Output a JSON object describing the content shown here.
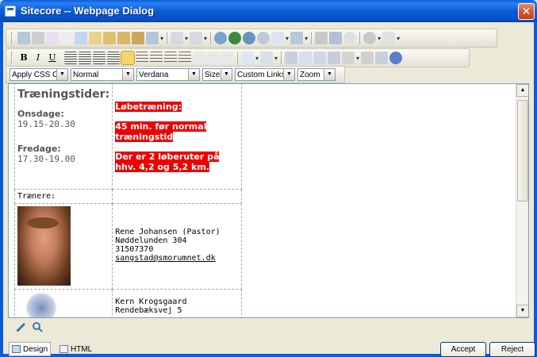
{
  "window": {
    "title": "Sitecore -- Webpage Dialog",
    "close_glyph": "✕"
  },
  "toolbar": {
    "style_class_placeholder": "Apply CSS Class",
    "paragraph_format": "Normal",
    "font_name": "Verdana",
    "font_size": "Size",
    "links": "Custom Links",
    "zoom": "Zoom",
    "format_buttons": [
      "B",
      "I",
      "U"
    ]
  },
  "document": {
    "heading": "Træningstider:",
    "schedule": [
      {
        "day": "Onsdage:",
        "time": "19.15-20.30"
      },
      {
        "day": "Fredage:",
        "time": "17.30-19.00"
      }
    ],
    "notes": [
      "Løbetræning:",
      "45 min. før normal træningstid",
      "Der er 2 løberuter på hhv. 4,2 og 5,2 km."
    ],
    "trainers_label": "Trænere:",
    "trainers": [
      {
        "name": "Rene Johansen (Pastor)",
        "address": "Nøddelunden 304",
        "phone": "31507370",
        "email": "sangstad@smorumnet.dk"
      },
      {
        "name": "Kern Krogsgaard",
        "address": "Rendebæksvej 5"
      }
    ]
  },
  "footer": {
    "design_tab": "Design",
    "html_tab": "HTML",
    "accept_label": "Accept",
    "reject_label": "Reject"
  },
  "icons": {
    "scroll_up": "▲",
    "scroll_down": "▼",
    "dropdown": "▼"
  }
}
